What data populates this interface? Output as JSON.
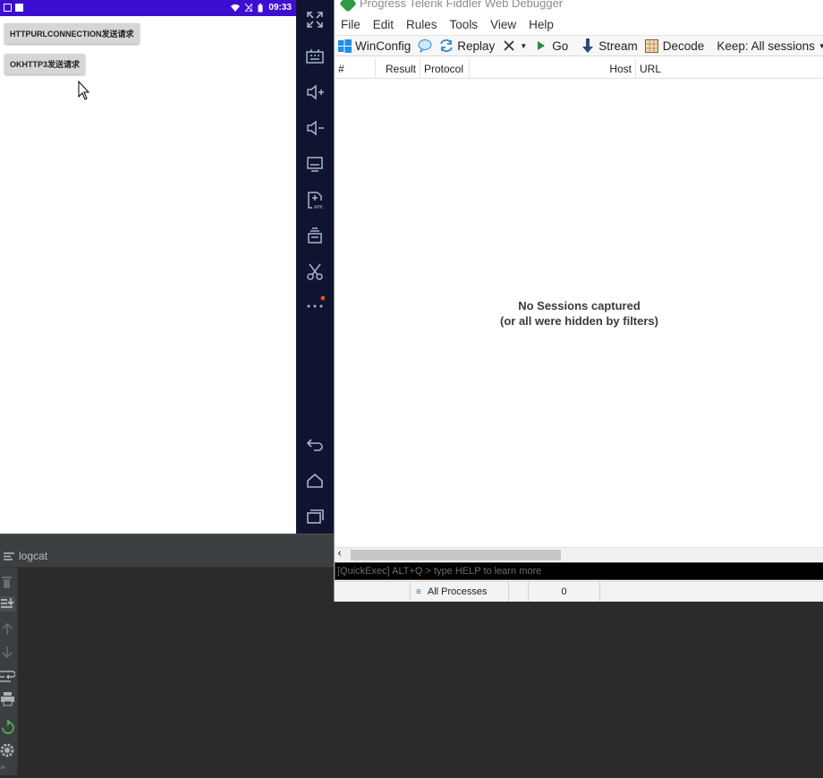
{
  "phone": {
    "status_time": "09:33",
    "buttons": [
      {
        "label": "HTTPURLCONNECTION发送请求"
      },
      {
        "label": "OKHTTP3发送请求"
      }
    ]
  },
  "emulator_toolbar": {
    "icons": [
      "fullscreen-icon",
      "keyboard-icon",
      "volume-up-icon",
      "volume-down-icon",
      "screen-icon",
      "install-apk-icon",
      "multi-window-icon",
      "scissors-icon",
      "more-icon",
      "back-icon",
      "home-icon",
      "recents-icon"
    ]
  },
  "fiddler": {
    "title": "Progress Telerik Fiddler Web Debugger",
    "menu": [
      "File",
      "Edit",
      "Rules",
      "Tools",
      "View",
      "Help"
    ],
    "toolbar": {
      "winconfig": "WinConfig",
      "replay": "Replay",
      "go": "Go",
      "stream": "Stream",
      "decode": "Decode",
      "keep": "Keep: All sessions"
    },
    "columns": [
      "#",
      "Result",
      "Protocol",
      "Host",
      "URL"
    ],
    "empty_line1": "No Sessions captured",
    "empty_line2": "(or all were hidden by filters)",
    "quickexec": "[QuickExec] ALT+Q > type HELP to learn more",
    "status": {
      "processes": "All Processes",
      "count": "0"
    }
  },
  "logcat": {
    "tab_label": "logcat"
  },
  "colors": {
    "android_status": "#3b0ed1",
    "emulator_bar": "#0f1530",
    "ide_bg": "#2b2b2b"
  }
}
